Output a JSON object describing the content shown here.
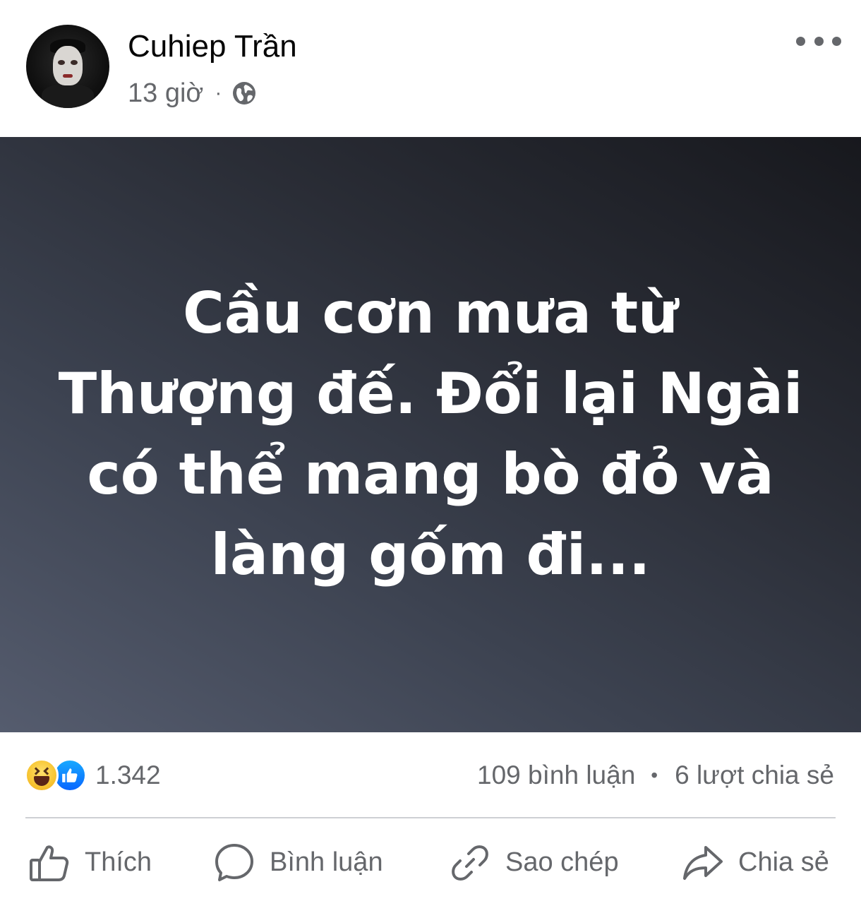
{
  "post": {
    "author": {
      "name": "Cuhiep Trần",
      "avatar_icon": "profile-avatar"
    },
    "meta": {
      "time": "13 giờ",
      "separator": "·",
      "privacy_icon": "globe-icon"
    },
    "more_icon": "more-horizontal-icon",
    "background_text": "Cầu cơn mưa từ Thượng đế. Đổi lại Ngài có thể mang bò đỏ và làng gốm đi...",
    "background_colors": [
      "#555c6e",
      "#17181d"
    ]
  },
  "stats": {
    "reaction_icons": [
      "haha-icon",
      "like-icon"
    ],
    "reaction_count": "1.342",
    "comments": "109 bình luận",
    "bullet": "•",
    "shares": "6 lượt chia sẻ"
  },
  "actions": {
    "like": "Thích",
    "comment": "Bình luận",
    "copy": "Sao chép",
    "share": "Chia sẻ"
  },
  "colors": {
    "secondary_text": "#65676b",
    "like_blue": "#0866ff",
    "haha_yellow": "#f7c532"
  }
}
